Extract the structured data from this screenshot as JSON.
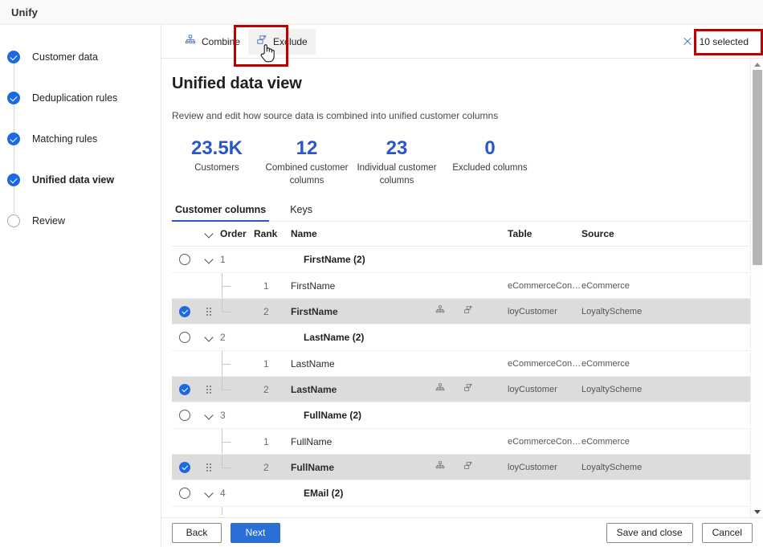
{
  "app": {
    "title": "Unify"
  },
  "wizard": {
    "steps": [
      {
        "label": "Customer data",
        "state": "done",
        "current": false
      },
      {
        "label": "Deduplication rules",
        "state": "done",
        "current": false
      },
      {
        "label": "Matching rules",
        "state": "done",
        "current": false
      },
      {
        "label": "Unified data view",
        "state": "done",
        "current": true
      },
      {
        "label": "Review",
        "state": "todo",
        "current": false
      }
    ]
  },
  "commandbar": {
    "combine": {
      "label": "Combine",
      "icon": "combine-icon"
    },
    "exclude": {
      "label": "Exclude",
      "icon": "exclude-icon",
      "hovered": true
    },
    "selection": {
      "label": "10 selected",
      "icon": "close-icon",
      "count": 10
    }
  },
  "page": {
    "title": "Unified data view",
    "subtitle": "Review and edit how source data is combined into unified customer columns"
  },
  "kpis": [
    {
      "value": "23.5K",
      "caption": "Customers"
    },
    {
      "value": "12",
      "caption": "Combined customer columns"
    },
    {
      "value": "23",
      "caption": "Individual customer columns"
    },
    {
      "value": "0",
      "caption": "Excluded columns"
    }
  ],
  "tabs": [
    {
      "label": "Customer columns",
      "active": true
    },
    {
      "label": "Keys",
      "active": false
    }
  ],
  "grid": {
    "columns": [
      "",
      "",
      "Order",
      "Rank",
      "Name",
      "",
      "Table",
      "Source"
    ],
    "headers": {
      "order": "Order",
      "rank": "Rank",
      "name": "Name",
      "table": "Table",
      "source": "Source"
    },
    "rows": [
      {
        "kind": "group",
        "checked": false,
        "order": "1",
        "rank": "",
        "name": "FirstName (2)",
        "table": "",
        "source": ""
      },
      {
        "kind": "child",
        "checked": false,
        "order": "",
        "rank": "1",
        "name": "FirstName",
        "table": "eCommerceConta...",
        "source": "eCommerce"
      },
      {
        "kind": "child",
        "checked": true,
        "order": "",
        "rank": "2",
        "name": "FirstName",
        "table": "loyCustomer",
        "source": "LoyaltyScheme"
      },
      {
        "kind": "group",
        "checked": false,
        "order": "2",
        "rank": "",
        "name": "LastName (2)",
        "table": "",
        "source": ""
      },
      {
        "kind": "child",
        "checked": false,
        "order": "",
        "rank": "1",
        "name": "LastName",
        "table": "eCommerceConta...",
        "source": "eCommerce"
      },
      {
        "kind": "child",
        "checked": true,
        "order": "",
        "rank": "2",
        "name": "LastName",
        "table": "loyCustomer",
        "source": "LoyaltyScheme"
      },
      {
        "kind": "group",
        "checked": false,
        "order": "3",
        "rank": "",
        "name": "FullName (2)",
        "table": "",
        "source": ""
      },
      {
        "kind": "child",
        "checked": false,
        "order": "",
        "rank": "1",
        "name": "FullName",
        "table": "eCommerceConta...",
        "source": "eCommerce"
      },
      {
        "kind": "child",
        "checked": true,
        "order": "",
        "rank": "2",
        "name": "FullName",
        "table": "loyCustomer",
        "source": "LoyaltyScheme"
      },
      {
        "kind": "group",
        "checked": false,
        "order": "4",
        "rank": "",
        "name": "EMail (2)",
        "table": "",
        "source": ""
      }
    ]
  },
  "footer": {
    "back": "Back",
    "next": "Next",
    "save_and_close": "Save and close",
    "cancel": "Cancel"
  },
  "colors": {
    "accent_blue": "#2a56c6",
    "check_blue": "#1b6ae3",
    "primary_button": "#2a6fd6",
    "annotation_red": "#c00000",
    "selected_row": "#dedcda"
  }
}
